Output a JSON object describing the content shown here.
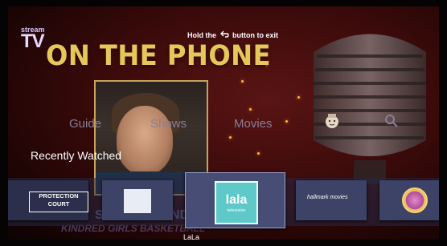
{
  "app": {
    "logo_small": "stream",
    "logo_big": "TV"
  },
  "hero": {
    "title": "ON THE PHONE"
  },
  "hint": {
    "before": "Hold the",
    "after": "button to exit"
  },
  "nav": {
    "items": [
      {
        "label": "Guide"
      },
      {
        "label": "Shows"
      },
      {
        "label": "Movies"
      }
    ],
    "icons": [
      "character-avatar-icon",
      "search-icon"
    ]
  },
  "rows": {
    "recent_title": "Recently Watched",
    "tiles": [
      {
        "name": "protection-court",
        "lines": [
          "PROTECTION",
          "COURT"
        ]
      },
      {
        "name": "blank-tile",
        "lines": []
      },
      {
        "name": "lala",
        "lines": [
          "lala",
          "television"
        ],
        "focused": true
      },
      {
        "name": "hallmark-movies",
        "lines": [
          "hallmark movies"
        ]
      },
      {
        "name": "circle-channel",
        "lines": []
      }
    ],
    "focused_label": "LaLa",
    "behind_text_a": "S",
    "behind_text_b": "ND",
    "behind_caption": "KINDRED GIRLS BASKETBALL"
  },
  "colors": {
    "title_gold": "#e6c85a",
    "nav_inactive": "#8a7f98",
    "lala_teal": "#5fc9c9"
  }
}
